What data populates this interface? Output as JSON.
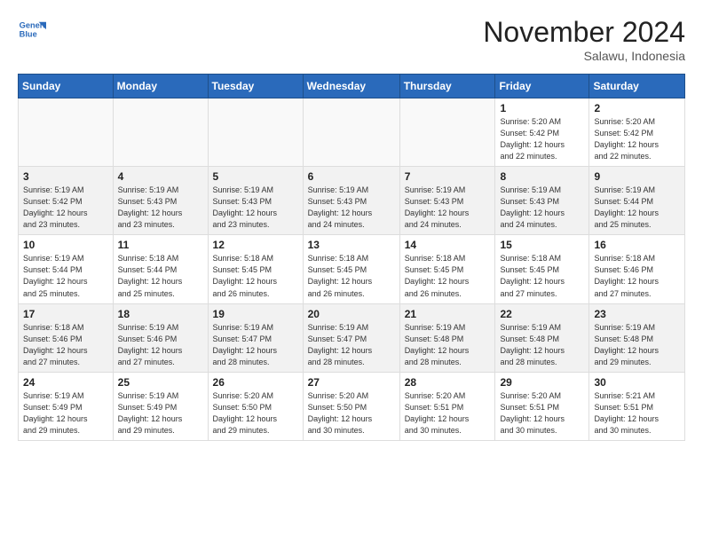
{
  "header": {
    "logo_line1": "General",
    "logo_line2": "Blue",
    "month_title": "November 2024",
    "location": "Salawu, Indonesia"
  },
  "days_of_week": [
    "Sunday",
    "Monday",
    "Tuesday",
    "Wednesday",
    "Thursday",
    "Friday",
    "Saturday"
  ],
  "weeks": [
    [
      {
        "day": "",
        "info": ""
      },
      {
        "day": "",
        "info": ""
      },
      {
        "day": "",
        "info": ""
      },
      {
        "day": "",
        "info": ""
      },
      {
        "day": "",
        "info": ""
      },
      {
        "day": "1",
        "info": "Sunrise: 5:20 AM\nSunset: 5:42 PM\nDaylight: 12 hours\nand 22 minutes."
      },
      {
        "day": "2",
        "info": "Sunrise: 5:20 AM\nSunset: 5:42 PM\nDaylight: 12 hours\nand 22 minutes."
      }
    ],
    [
      {
        "day": "3",
        "info": "Sunrise: 5:19 AM\nSunset: 5:42 PM\nDaylight: 12 hours\nand 23 minutes."
      },
      {
        "day": "4",
        "info": "Sunrise: 5:19 AM\nSunset: 5:43 PM\nDaylight: 12 hours\nand 23 minutes."
      },
      {
        "day": "5",
        "info": "Sunrise: 5:19 AM\nSunset: 5:43 PM\nDaylight: 12 hours\nand 23 minutes."
      },
      {
        "day": "6",
        "info": "Sunrise: 5:19 AM\nSunset: 5:43 PM\nDaylight: 12 hours\nand 24 minutes."
      },
      {
        "day": "7",
        "info": "Sunrise: 5:19 AM\nSunset: 5:43 PM\nDaylight: 12 hours\nand 24 minutes."
      },
      {
        "day": "8",
        "info": "Sunrise: 5:19 AM\nSunset: 5:43 PM\nDaylight: 12 hours\nand 24 minutes."
      },
      {
        "day": "9",
        "info": "Sunrise: 5:19 AM\nSunset: 5:44 PM\nDaylight: 12 hours\nand 25 minutes."
      }
    ],
    [
      {
        "day": "10",
        "info": "Sunrise: 5:19 AM\nSunset: 5:44 PM\nDaylight: 12 hours\nand 25 minutes."
      },
      {
        "day": "11",
        "info": "Sunrise: 5:18 AM\nSunset: 5:44 PM\nDaylight: 12 hours\nand 25 minutes."
      },
      {
        "day": "12",
        "info": "Sunrise: 5:18 AM\nSunset: 5:45 PM\nDaylight: 12 hours\nand 26 minutes."
      },
      {
        "day": "13",
        "info": "Sunrise: 5:18 AM\nSunset: 5:45 PM\nDaylight: 12 hours\nand 26 minutes."
      },
      {
        "day": "14",
        "info": "Sunrise: 5:18 AM\nSunset: 5:45 PM\nDaylight: 12 hours\nand 26 minutes."
      },
      {
        "day": "15",
        "info": "Sunrise: 5:18 AM\nSunset: 5:45 PM\nDaylight: 12 hours\nand 27 minutes."
      },
      {
        "day": "16",
        "info": "Sunrise: 5:18 AM\nSunset: 5:46 PM\nDaylight: 12 hours\nand 27 minutes."
      }
    ],
    [
      {
        "day": "17",
        "info": "Sunrise: 5:18 AM\nSunset: 5:46 PM\nDaylight: 12 hours\nand 27 minutes."
      },
      {
        "day": "18",
        "info": "Sunrise: 5:19 AM\nSunset: 5:46 PM\nDaylight: 12 hours\nand 27 minutes."
      },
      {
        "day": "19",
        "info": "Sunrise: 5:19 AM\nSunset: 5:47 PM\nDaylight: 12 hours\nand 28 minutes."
      },
      {
        "day": "20",
        "info": "Sunrise: 5:19 AM\nSunset: 5:47 PM\nDaylight: 12 hours\nand 28 minutes."
      },
      {
        "day": "21",
        "info": "Sunrise: 5:19 AM\nSunset: 5:48 PM\nDaylight: 12 hours\nand 28 minutes."
      },
      {
        "day": "22",
        "info": "Sunrise: 5:19 AM\nSunset: 5:48 PM\nDaylight: 12 hours\nand 28 minutes."
      },
      {
        "day": "23",
        "info": "Sunrise: 5:19 AM\nSunset: 5:48 PM\nDaylight: 12 hours\nand 29 minutes."
      }
    ],
    [
      {
        "day": "24",
        "info": "Sunrise: 5:19 AM\nSunset: 5:49 PM\nDaylight: 12 hours\nand 29 minutes."
      },
      {
        "day": "25",
        "info": "Sunrise: 5:19 AM\nSunset: 5:49 PM\nDaylight: 12 hours\nand 29 minutes."
      },
      {
        "day": "26",
        "info": "Sunrise: 5:20 AM\nSunset: 5:50 PM\nDaylight: 12 hours\nand 29 minutes."
      },
      {
        "day": "27",
        "info": "Sunrise: 5:20 AM\nSunset: 5:50 PM\nDaylight: 12 hours\nand 30 minutes."
      },
      {
        "day": "28",
        "info": "Sunrise: 5:20 AM\nSunset: 5:51 PM\nDaylight: 12 hours\nand 30 minutes."
      },
      {
        "day": "29",
        "info": "Sunrise: 5:20 AM\nSunset: 5:51 PM\nDaylight: 12 hours\nand 30 minutes."
      },
      {
        "day": "30",
        "info": "Sunrise: 5:21 AM\nSunset: 5:51 PM\nDaylight: 12 hours\nand 30 minutes."
      }
    ]
  ]
}
